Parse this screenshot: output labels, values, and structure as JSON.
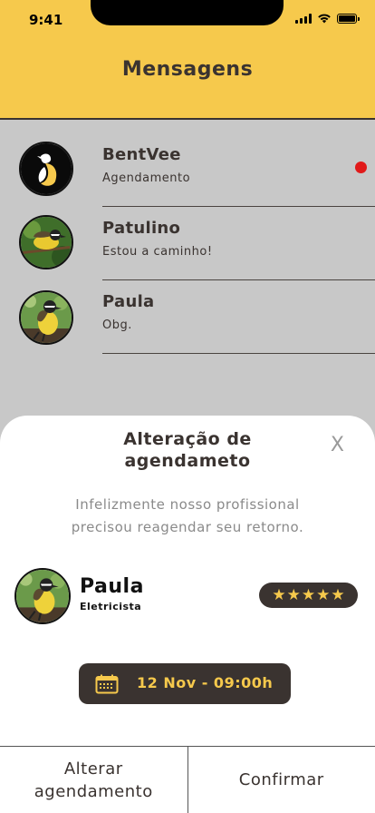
{
  "status_bar": {
    "time": "9:41"
  },
  "header": {
    "title": "Mensagens"
  },
  "messages": [
    {
      "name": "BentVee",
      "preview": "Agendamento",
      "unread": true
    },
    {
      "name": "Patulino",
      "preview": "Estou a caminho!",
      "unread": false
    },
    {
      "name": "Paula",
      "preview": "Obg.",
      "unread": false
    }
  ],
  "sheet": {
    "title_line1": "Alteração de",
    "title_line2": "agendameto",
    "close_label": "X",
    "message_line1": "Infelizmente nosso profissional",
    "message_line2": "precisou reagendar seu retorno.",
    "professional": {
      "name": "Paula",
      "role": "Eletricista",
      "rating": 5
    },
    "date": "12 Nov - 09:00h",
    "alter_line1": "Alterar",
    "alter_line2": "agendamento",
    "confirm_label": "Confirmar"
  },
  "colors": {
    "accent": "#f6c94c",
    "dark": "#3a3330",
    "unread": "#e11a1a",
    "overlay": "#c8c8c8"
  },
  "icons": {
    "calendar": "calendar-icon",
    "star": "star-icon"
  }
}
